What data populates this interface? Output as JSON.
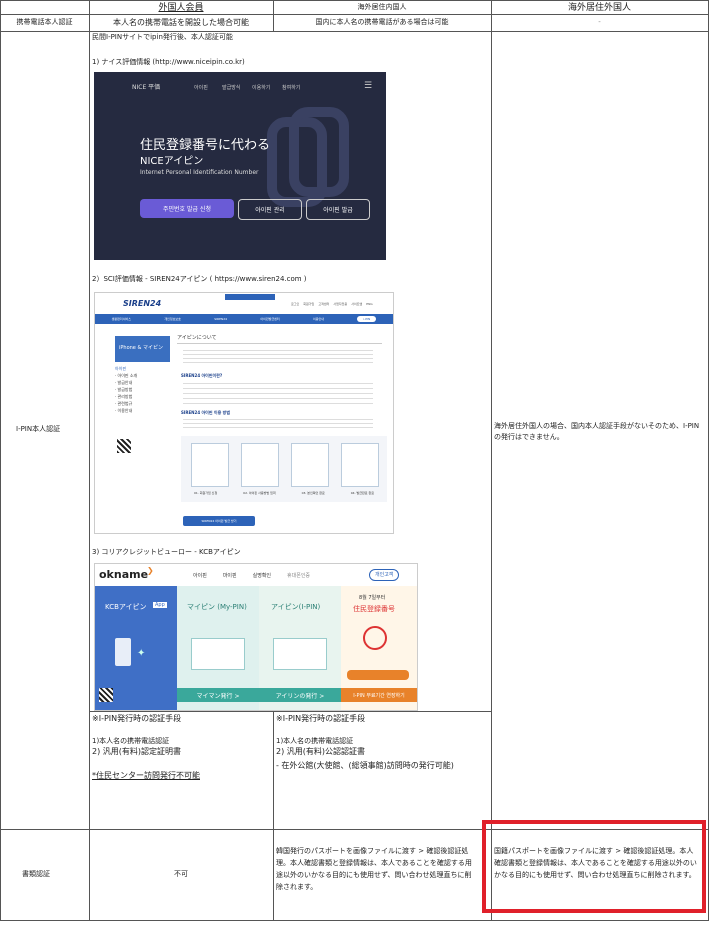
{
  "header": {
    "col_foreign_member": "外国人会員",
    "col_overseas_domestic": "海外居住内国人",
    "col_overseas_foreign": "海外居住外国人"
  },
  "rows": {
    "phone": {
      "label": "携帯電話本人認証",
      "foreign": "本人名の携帯電話を開設した場合可能",
      "domestic": "国内に本人名の携帯電話がある場合は可能",
      "overseas": "-"
    },
    "ipin": {
      "label": "I-PIN本人認証",
      "intro": "民間I-PINサイトでipin発行後、本人認証可能",
      "site1": "1) ナイス評価情報 (http://www.niceipin.co.kr)",
      "site2": "2）SCI評価情報 - SIREN24アイピン ( https://www.siren24.com )",
      "site3": "3) コリアクレジットビューロー - KCBアイピン",
      "overseas_note": "海外居住外国人の場合、国内本人認証手段がないそのため、I-PINの発行はできません。",
      "foreign_auth_title": "※I-PIN発行時の認証手段",
      "foreign_auth_1": "1)本人名の携帯電話認証",
      "foreign_auth_2": "2) 汎用(有料)認定証明書",
      "foreign_auth_3": "*住民センター訪問発行不可能",
      "domestic_auth_title": "※I-PIN発行時の認証手段",
      "domestic_auth_1": "1)本人名の携帯電話認証",
      "domestic_auth_2": "2) 汎用(有料)公認認証書",
      "domestic_auth_3": "- 在外公館(大使館、(総領事館)訪問時の発行可能)"
    },
    "docs": {
      "label": "書類認証",
      "foreign": "不可",
      "domestic": "韓国発行のパスポートを画像ファイルに渡す > 確認後認証処理。本人確認書類と登録情報は、本人であることを確認する用途以外のいかなる目的にも使用せず、問い合わせ処理直ちに削除されます。",
      "overseas": "国籍パスポートを画像ファイルに渡す > 確認後認証処理。本人確認書類と登録情報は、本人であることを確認する用途以外のいかなる目的にも使用せず、問い合わせ処理直ちに削除されます。"
    }
  },
  "nice": {
    "logo": "NICE 平価",
    "nav": [
      "아이핀",
      "발급방식",
      "이용하기",
      "참여하기"
    ],
    "headline": "住民登録番号に代わる",
    "subhead": "NICEアイピン",
    "tagline": "Internet Personal Identification Number",
    "btn1": "주민번호 발급 신청",
    "btn2": "아이핀 관리",
    "btn3": "아이핀 발급"
  },
  "siren": {
    "logo": "SIREN24",
    "topnav": [
      "로그인",
      "회원가입",
      "고객센터",
      "사업자전용",
      "사이트맵",
      "ENG"
    ],
    "menu": [
      "생활편리서비스",
      "개인정보보호",
      "SIREN24",
      "아이핀발급센터",
      "이용안내",
      "i-PIN"
    ],
    "side_title": "iPhone & マイピン",
    "side_items": [
      "아이핀",
      "· 아이핀 소개",
      "· 발급안내",
      "· 발급방법",
      "· 관리방법",
      "· 관련법규",
      "· 이용안내"
    ],
    "section_title": "アイピンについて",
    "q1": "SIREN24 아이핀이란?",
    "q2": "SIREN24 아이핀 이용 방법",
    "steps": [
      "01. 회원가입 신청",
      "02. 아이핀 사용방법 입력",
      "03. 본인확인 완료",
      "04. 발급완료 완료"
    ],
    "cta": "SIREN24 아이핀 발급 받기"
  },
  "kcb": {
    "logo": "okname",
    "nav": [
      "아이핀",
      "마이핀",
      "실명확인",
      "휴대폰인증"
    ],
    "btn_login": "개인고객",
    "card1_title": "KCBアイピン",
    "card1_badge": "App",
    "card2_title": "マイピン (My-PIN)",
    "card3_title": "アイピン(I-PIN)",
    "card4_title": "住民登録番号",
    "card4_sub": "8월 7일부터",
    "btn_mypin": "マイマン発行 >",
    "btn_ipin": "アイリンの発行 >",
    "btn_cta": "I-PIN 무료기간 연장하기"
  },
  "colors": {
    "nice_bg": "#252a40",
    "siren_blue": "#2d63b8",
    "kcb_green": "#3aa89b",
    "kcb_orange": "#e8822a",
    "highlight_red": "#e0202a"
  }
}
